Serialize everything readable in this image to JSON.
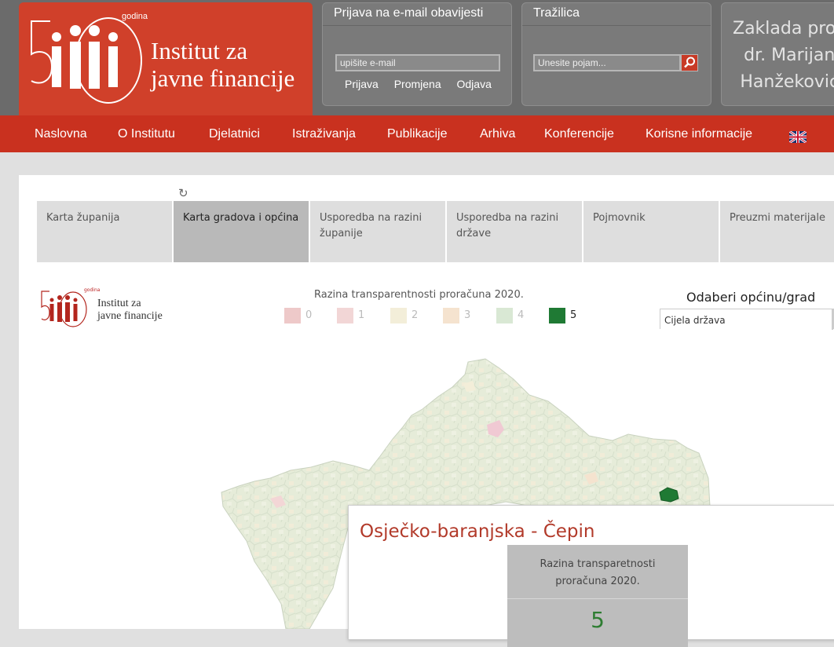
{
  "header": {
    "logo": {
      "godina": "godina",
      "line1": "Institut za",
      "line2": "javne financije"
    },
    "mail": {
      "title": "Prijava na e-mail obavijesti",
      "placeholder": "upišite e-mail",
      "links": [
        "Prijava",
        "Promjena",
        "Odjava"
      ]
    },
    "search": {
      "title": "Tražilica",
      "placeholder": "Unesite pojam..."
    },
    "zaklada": {
      "line1": "Zaklada prof.",
      "line2": "dr. Marijan",
      "line3": "Hanžeković"
    }
  },
  "nav": [
    "Naslovna",
    "O Institutu",
    "Djelatnici",
    "Istraživanja",
    "Publikacije",
    "Arhiva",
    "Konferencije",
    "Korisne informacije"
  ],
  "tabs": [
    "Karta županija",
    "Karta gradova i općina",
    "Usporedba na razini županije",
    "Usporedba na razini države",
    "Pojmovnik",
    "Preuzmi materijale"
  ],
  "active_tab": 1,
  "small_logo": {
    "godina": "godina",
    "line1": "Institut za",
    "line2": "javne financije"
  },
  "legend": {
    "title": "Razina transparentnosti proračuna 2020.",
    "items": [
      {
        "label": "0",
        "color": "#eec9c9"
      },
      {
        "label": "1",
        "color": "#f2d6d6"
      },
      {
        "label": "2",
        "color": "#f3eed9"
      },
      {
        "label": "3",
        "color": "#f5e3cf"
      },
      {
        "label": "4",
        "color": "#d9e8d4"
      },
      {
        "label": "5",
        "color": "#1f7a34"
      }
    ]
  },
  "selector": {
    "label": "Odaberi općinu/grad",
    "value": "Cijela država"
  },
  "tooltip": {
    "title": "Osječko-baranjska - Čepin",
    "caption1": "Razina transparetnosti",
    "caption2": "proračuna  2020.",
    "value": "5"
  },
  "colors": {
    "brand_red": "#c9311f",
    "header_gray": "#6b6b6b",
    "highlight_green": "#1f7a34"
  }
}
